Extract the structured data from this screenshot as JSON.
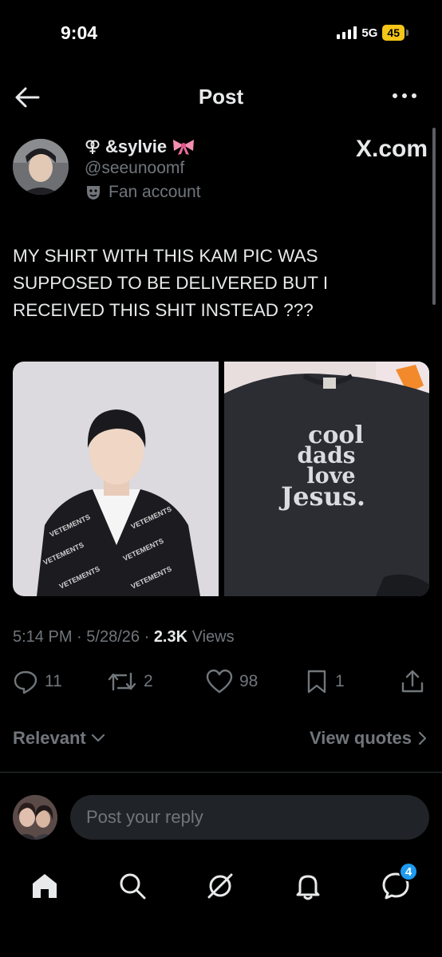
{
  "status_bar": {
    "time": "9:04",
    "network": "5G",
    "battery": "45"
  },
  "header": {
    "title": "Post"
  },
  "author": {
    "display_name": "&sylvie",
    "handle": "@seeunoomf",
    "label": "Fan account",
    "source": "X.com"
  },
  "post": {
    "text": "MY SHIRT WITH THIS KAM PIC WAS SUPPOSED TO BE DELIVERED BUT I RECEIVED THIS SHIT INSTEAD ???",
    "shirt_lines": [
      "cool",
      "dads",
      "love",
      "Jesus."
    ],
    "time": "5:14 PM",
    "date": "5/28/26",
    "views_count": "2.3K",
    "views_label": "Views",
    "sep": "·"
  },
  "actions": {
    "replies": "11",
    "reposts": "2",
    "likes": "98",
    "bookmarks": "1"
  },
  "sort": {
    "relevant": "Relevant",
    "view_quotes": "View quotes"
  },
  "reply": {
    "placeholder": "Post your reply"
  },
  "tabbar": {
    "messages_badge": "4"
  },
  "colors": {
    "accent": "#1d9bf0",
    "muted": "#71767b",
    "text": "#e7e9ea",
    "battery": "#f5c518"
  }
}
